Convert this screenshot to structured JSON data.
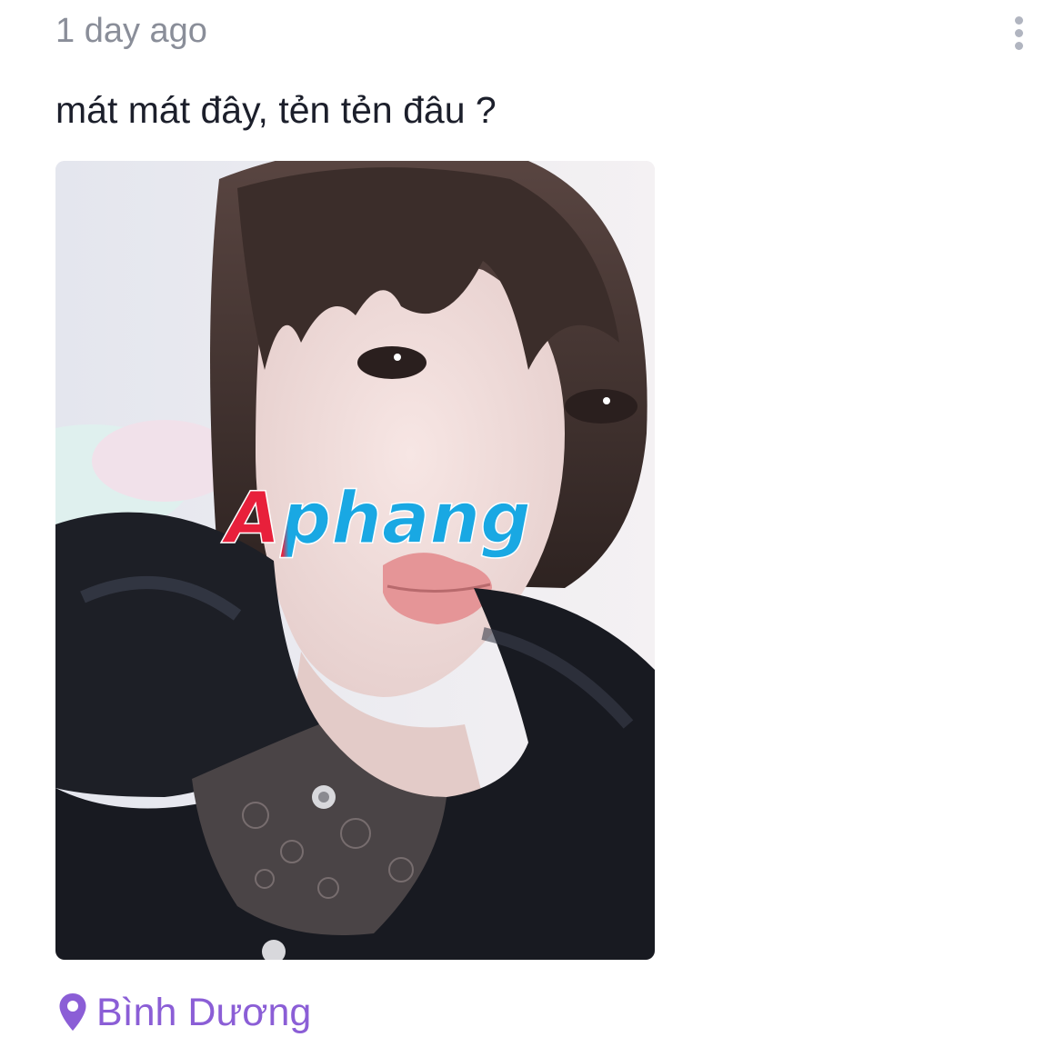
{
  "post": {
    "timestamp": "1 day ago",
    "text": "mát mát đây, tẻn tẻn đâu ?",
    "location": "Bình Dương",
    "watermark": "Aphang"
  },
  "icons": {
    "more": "more-vertical-icon",
    "location": "map-pin-icon"
  },
  "colors": {
    "timestamp": "#8a8e99",
    "text": "#1c1f2b",
    "location": "#8b5ed6",
    "more_dots": "#b1b5c0"
  }
}
